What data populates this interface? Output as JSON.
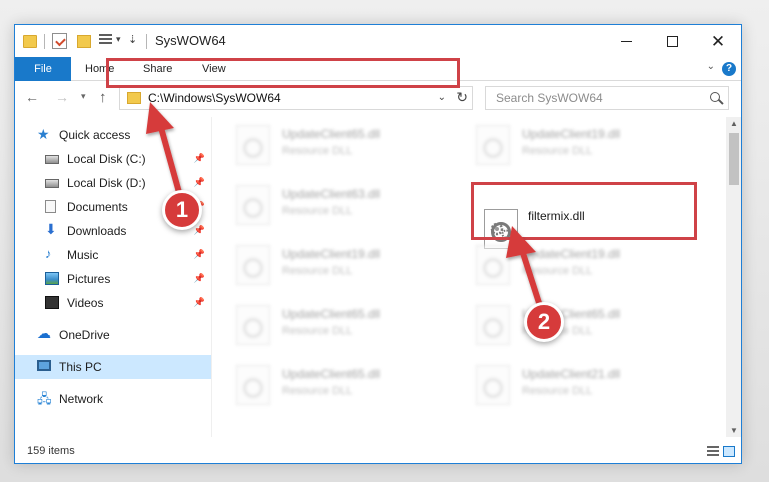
{
  "window": {
    "title": "SysWOW64",
    "accent": "#1979ca",
    "highlight_color": "#cf4247"
  },
  "ribbon": {
    "tabs": [
      "File",
      "Home",
      "Share",
      "View"
    ]
  },
  "address_bar": {
    "path": "C:\\Windows\\SysWOW64"
  },
  "search": {
    "placeholder": "Search SysWOW64"
  },
  "sidebar": {
    "quick_access": "Quick access",
    "items": [
      {
        "label": "Local Disk (C:)",
        "icon": "disk-icon",
        "pinned": true
      },
      {
        "label": "Local Disk (D:)",
        "icon": "disk-icon",
        "pinned": true
      },
      {
        "label": "Documents",
        "icon": "document-icon",
        "pinned": true
      },
      {
        "label": "Downloads",
        "icon": "download-icon",
        "pinned": true
      },
      {
        "label": "Music",
        "icon": "music-icon",
        "pinned": true
      },
      {
        "label": "Pictures",
        "icon": "picture-icon",
        "pinned": true
      },
      {
        "label": "Videos",
        "icon": "video-icon",
        "pinned": true
      }
    ],
    "onedrive": "OneDrive",
    "this_pc": "This PC",
    "network": "Network"
  },
  "files": {
    "left_column": [
      {
        "name": "UpdateClient65.dll",
        "type": "Resource DLL"
      },
      {
        "name": "UpdateClient63.dll",
        "type": "Resource DLL"
      },
      {
        "name": "UpdateClient19.dll",
        "type": "Resource DLL"
      },
      {
        "name": "UpdateClient65.dll",
        "type": "Resource DLL"
      },
      {
        "name": "UpdateClient65.dll",
        "type": "Resource DLL"
      }
    ],
    "right_column": [
      {
        "name": "UpdateClient19.dll",
        "type": "Resource DLL"
      },
      {
        "name": "filtermix.dll",
        "type": ""
      },
      {
        "name": "UpdateClient19.dll",
        "type": "Resource DLL"
      },
      {
        "name": "UpdateClient65.dll",
        "type": "Resource DLL"
      },
      {
        "name": "UpdateClient21.dll",
        "type": "Resource DLL"
      }
    ]
  },
  "status": {
    "item_count": "159 items"
  },
  "annotations": {
    "step1": "1",
    "step2": "2"
  }
}
